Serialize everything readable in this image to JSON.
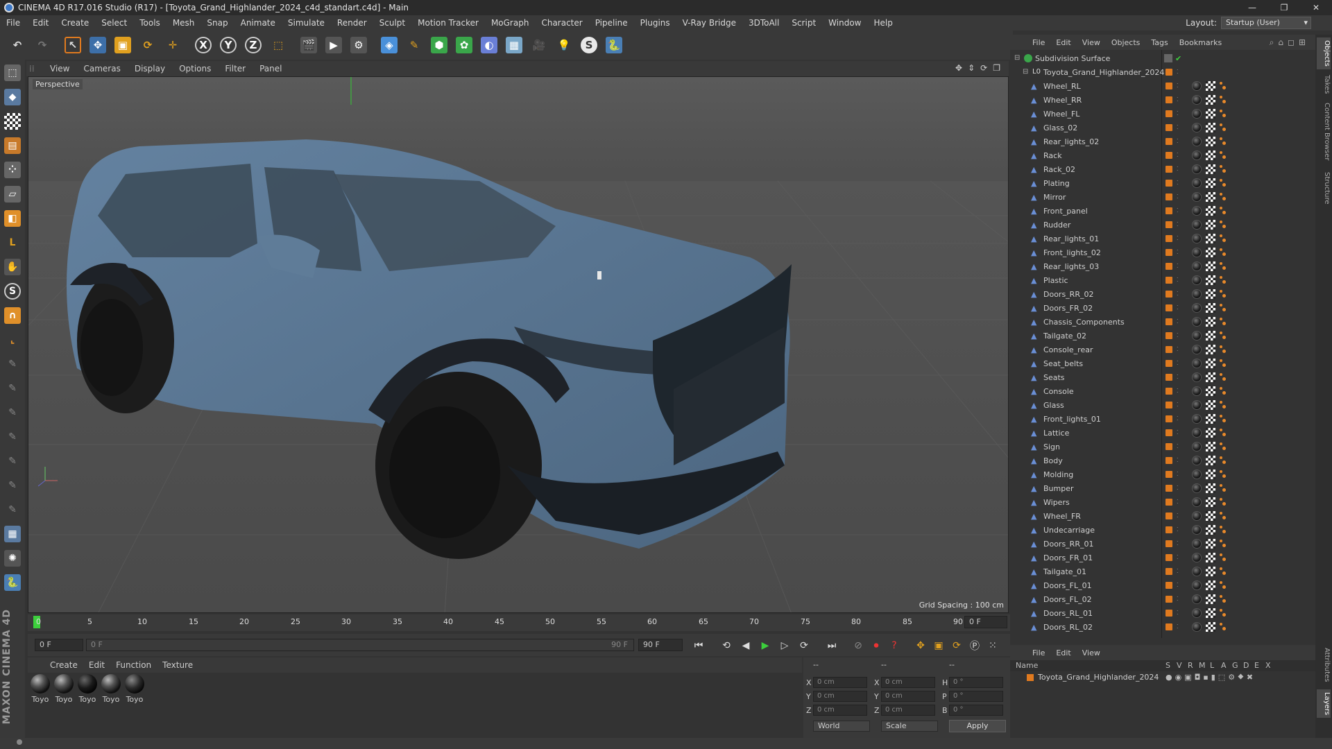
{
  "window": {
    "title": "CINEMA 4D R17.016 Studio (R17) - [Toyota_Grand_Highlander_2024_c4d_standart.c4d] - Main",
    "controls": [
      "—",
      "❐",
      "✕"
    ]
  },
  "menubar": {
    "items": [
      "File",
      "Edit",
      "Create",
      "Select",
      "Tools",
      "Mesh",
      "Snap",
      "Animate",
      "Simulate",
      "Render",
      "Sculpt",
      "Motion Tracker",
      "MoGraph",
      "Character",
      "Pipeline",
      "Plugins",
      "V-Ray Bridge",
      "3DToAll",
      "Script",
      "Window",
      "Help"
    ],
    "layout_label": "Layout:",
    "layout_value": "Startup (User)"
  },
  "toolbar": {
    "axis_x": "X",
    "axis_y": "Y",
    "axis_z": "Z"
  },
  "viewport": {
    "menu": [
      "View",
      "Cameras",
      "Display",
      "Options",
      "Filter",
      "Panel"
    ],
    "camera_label": "Perspective",
    "grid_spacing": "Grid Spacing : 100 cm"
  },
  "timeline": {
    "ticks": [
      "0",
      "5",
      "10",
      "15",
      "20",
      "25",
      "30",
      "35",
      "40",
      "45",
      "50",
      "55",
      "60",
      "65",
      "70",
      "75",
      "80",
      "85",
      "90"
    ],
    "current_frame": "0 F",
    "start_field": "0 F",
    "range_start": "0 F",
    "range_end": "90 F",
    "end_field": "90 F"
  },
  "material_manager": {
    "menu": [
      "Create",
      "Edit",
      "Function",
      "Texture"
    ],
    "materials": [
      "Toyo",
      "Toyo",
      "Toyo",
      "Toyo",
      "Toyo"
    ]
  },
  "coordinates": {
    "header_left": "--",
    "header_mid": "--",
    "header_right": "--",
    "rows": [
      {
        "axis": "X",
        "pos": "0 cm",
        "axis2": "X",
        "size": "0 cm",
        "rot_label": "H",
        "rot": "0 °"
      },
      {
        "axis": "Y",
        "pos": "0 cm",
        "axis2": "Y",
        "size": "0 cm",
        "rot_label": "P",
        "rot": "0 °"
      },
      {
        "axis": "Z",
        "pos": "0 cm",
        "axis2": "Z",
        "size": "0 cm",
        "rot_label": "B",
        "rot": "0 °"
      }
    ],
    "space": "World",
    "mode": "Scale",
    "apply_label": "Apply"
  },
  "object_manager": {
    "menu": [
      "File",
      "Edit",
      "View",
      "Objects",
      "Tags",
      "Bookmarks"
    ],
    "root": "Subdivision Surface",
    "group": "Toyota_Grand_Highlander_2024",
    "objects": [
      "Wheel_RL",
      "Wheel_RR",
      "Wheel_FL",
      "Glass_02",
      "Rear_lights_02",
      "Rack",
      "Rack_02",
      "Plating",
      "Mirror",
      "Front_panel",
      "Rudder",
      "Rear_lights_01",
      "Front_lights_02",
      "Rear_lights_03",
      "Plastic",
      "Doors_RR_02",
      "Doors_FR_02",
      "Chassis_Components",
      "Tailgate_02",
      "Console_rear",
      "Seat_belts",
      "Seats",
      "Console",
      "Glass",
      "Front_lights_01",
      "Lattice",
      "Sign",
      "Body",
      "Molding",
      "Bumper",
      "Wipers",
      "Wheel_FR",
      "Undecarriage",
      "Doors_RR_01",
      "Doors_FR_01",
      "Tailgate_01",
      "Doors_FL_01",
      "Doors_FL_02",
      "Doors_RL_01",
      "Doors_RL_02"
    ]
  },
  "layer_manager": {
    "menu": [
      "File",
      "Edit",
      "View"
    ],
    "columns": [
      "Name",
      "S",
      "V",
      "R",
      "M",
      "L",
      "A",
      "G",
      "D",
      "E",
      "X"
    ],
    "row_name": "Toyota_Grand_Highlander_2024"
  },
  "right_tabs": [
    "Objects",
    "Takes",
    "Content Browser",
    "Structure",
    "Attributes",
    "Layers"
  ],
  "brand": "MAXON CINEMA 4D",
  "colors": {
    "accent_orange": "#e07a1f",
    "car_body": "#5a7590",
    "ui_dark": "#333333"
  }
}
